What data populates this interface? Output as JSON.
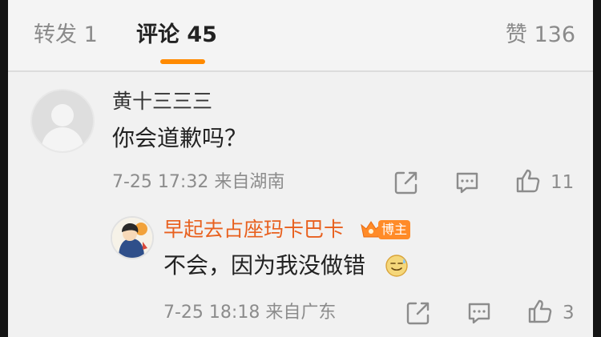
{
  "tabs": {
    "forward": "转发 1",
    "comment": "评论 45",
    "like": "赞 136"
  },
  "comments": [
    {
      "name": "黄十三三三",
      "text": "你会道歉吗？",
      "meta": "7-25 17:32  来自湖南",
      "likes": "11"
    }
  ],
  "reply": {
    "name": "早起去占座玛卡巴卡",
    "badge": "博主",
    "text": "不会，因为我没做错",
    "meta": "7-25 18:18  来自广东",
    "likes": "3"
  },
  "icons": {
    "share": "share-icon",
    "comment": "comment-icon",
    "like": "thumbs-up-icon",
    "crown": "crown-icon",
    "emoji": "sweat-smile-emoji-icon"
  },
  "colors": {
    "accent": "#ff8a00",
    "author": "#e8601e"
  }
}
